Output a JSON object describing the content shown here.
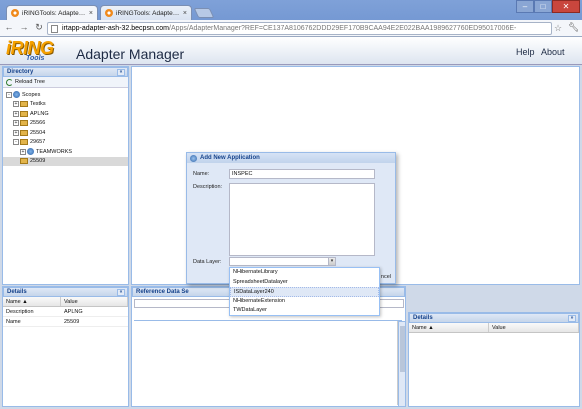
{
  "browser": {
    "tabs": [
      {
        "label": "iRINGTools: Adapter Manager",
        "active": true
      },
      {
        "label": "iRINGTools: Adapter Manager",
        "active": false
      }
    ],
    "close_glyph": "×",
    "url_host": "irtapp-adapter-ash-32.becpsn.com",
    "url_path": "/Apps/AdapterManager?REF=CE137A8106762DDD29EF170B9CAA94E2E022BAA1989627760ED95017006E-",
    "icons": {
      "back": "back-arrow-icon",
      "forward": "forward-arrow-icon",
      "reload": "reload-icon",
      "star": "star-icon",
      "wrench": "wrench-icon"
    }
  },
  "app": {
    "logo_text": "iRING",
    "logo_sub": "Tools",
    "title": "Adapter Manager",
    "links": {
      "help": "Help",
      "about": "About"
    }
  },
  "directory": {
    "title": "Directory",
    "reload_label": "Reload Tree",
    "tree": [
      {
        "label": "Scopes",
        "indent": 0,
        "icon": "globe",
        "exp": "-"
      },
      {
        "label": "Testks",
        "indent": 1,
        "icon": "folder",
        "exp": "+"
      },
      {
        "label": "APLNG",
        "indent": 1,
        "icon": "folder",
        "exp": "+"
      },
      {
        "label": "25566",
        "indent": 1,
        "icon": "folder",
        "exp": "+"
      },
      {
        "label": "25504",
        "indent": 1,
        "icon": "folder",
        "exp": "+"
      },
      {
        "label": "29657",
        "indent": 1,
        "icon": "folder",
        "exp": "-"
      },
      {
        "label": "TEAMWORKS",
        "indent": 2,
        "icon": "globe",
        "exp": "+"
      },
      {
        "label": "25509",
        "indent": 1,
        "icon": "folder",
        "exp": "",
        "selected": true
      }
    ]
  },
  "details": {
    "title": "Details",
    "columns": [
      "Name ▲",
      "Value"
    ],
    "rows": [
      {
        "name": "Description",
        "value": "APLNG"
      },
      {
        "name": "Name",
        "value": "25509"
      }
    ]
  },
  "reference_data": {
    "title": "Reference Data Se"
  },
  "ref_details": {
    "title": "Details",
    "columns": [
      "Name ▲",
      "Value"
    ]
  },
  "dialog": {
    "title": "Add New Application",
    "name_label": "Name:",
    "name_value": "INSPEC",
    "description_label": "Description:",
    "datalayer_label": "Data Layer:",
    "datalayer_value": "",
    "cancel_partial": "ncel"
  },
  "dropdown": {
    "options": [
      {
        "label": "NHibernateLibrary",
        "selected": false
      },
      {
        "label": "SpreadsheetDatalayer",
        "selected": false
      },
      {
        "label": "ISDataLayer240",
        "selected": true
      },
      {
        "label": "NHibernateExtension",
        "selected": false
      },
      {
        "label": "TWDataLayer",
        "selected": false
      }
    ]
  },
  "glyphs": {
    "collapse": "«",
    "collapse_right": "»",
    "expand_arrow": "▾"
  }
}
